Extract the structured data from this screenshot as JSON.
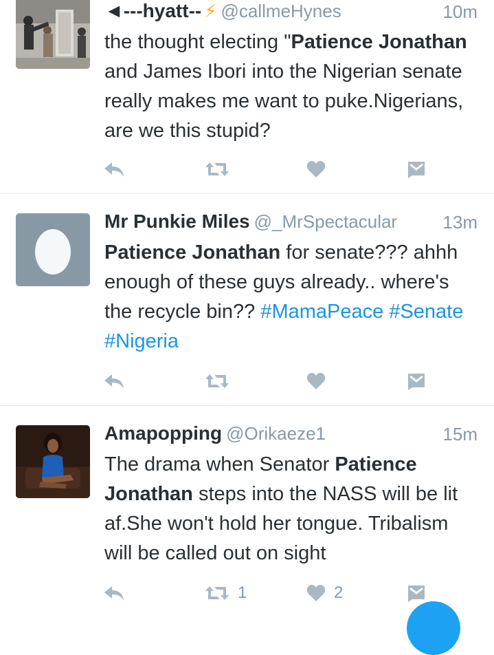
{
  "tweets": [
    {
      "name": "◄---hyatt--",
      "handle": "@callmeHynes",
      "time": "10m",
      "text_parts": [
        "the thought electing \"",
        "Patience Jonathan",
        " and James Ibori into the Nigerian senate really makes me want to puke.Nigerians, are we this stupid?"
      ],
      "retweets": "",
      "likes": ""
    },
    {
      "name": "Mr Punkie Miles",
      "handle": "@_MrSpectacular",
      "time": "13m",
      "text_parts": [
        "Patience Jonathan",
        " for senate??? ahhh enough of these guys already.. where's the recycle bin?? "
      ],
      "hashtags": [
        "#MamaPeace",
        "#Senate",
        "#Nigeria"
      ],
      "retweets": "",
      "likes": ""
    },
    {
      "name": "Amapopping",
      "handle": "@Orikaeze1",
      "time": "15m",
      "text_parts": [
        "The drama when Senator ",
        "Patience Jonathan",
        " steps into the NASS will be lit af.She won't hold her tongue. Tribalism will be called out on sight"
      ],
      "retweets": "1",
      "likes": "2"
    }
  ],
  "colors": {
    "text": "#292f33",
    "secondary": "#8899a6",
    "link": "#1b95e0",
    "icon": "#aab8c2",
    "bolt": "#ffad1f",
    "divider": "#e1e8ed",
    "fab": "#1da1f2"
  },
  "icons": [
    "reply-icon",
    "retweet-icon",
    "heart-icon",
    "direct-message-icon",
    "lightning-icon"
  ]
}
